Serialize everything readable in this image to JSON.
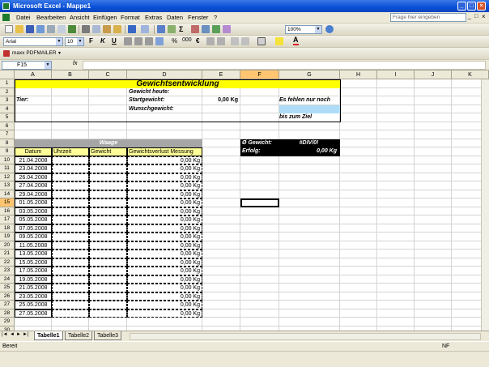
{
  "window": {
    "title": "Microsoft Excel - Mappe1"
  },
  "menu": {
    "items": [
      "Datei",
      "Bearbeiten",
      "Ansicht",
      "Einfügen",
      "Format",
      "Extras",
      "Daten",
      "Fenster",
      "?"
    ],
    "help_placeholder": "Frage hier eingeben"
  },
  "toolbar": {
    "zoom": "100%",
    "font": "Arial",
    "size": "10",
    "pdf_label": "maxx PDFMAILER"
  },
  "formula_bar": {
    "name_box": "F15",
    "fx": "fx",
    "content": ""
  },
  "grid": {
    "columns": [
      "A",
      "B",
      "C",
      "D",
      "E",
      "F",
      "G",
      "H",
      "I",
      "J",
      "K"
    ],
    "rows": [
      "1",
      "2",
      "3",
      "4",
      "5",
      "6",
      "7",
      "8",
      "9",
      "10",
      "11",
      "12",
      "13",
      "14",
      "15",
      "16",
      "17",
      "18",
      "19",
      "20",
      "21",
      "22",
      "23",
      "24",
      "25",
      "26",
      "27",
      "28",
      "29",
      "30"
    ],
    "selected_cell": "F15"
  },
  "sheet": {
    "title": "Gewichtsentwicklung",
    "tier_label": "Tier:",
    "gewicht_heute": "Gewicht heute:",
    "startgewicht": "Startgewicht:",
    "startgewicht_value": "0,00 Kg",
    "wunschgewicht": "Wunschgewicht:",
    "es_fehlen": "Es fehlen nur noch",
    "bis_zum_ziel": "bis zum Ziel",
    "waage": "Waage",
    "headers": [
      "Datum",
      "Uhrzeit",
      "Gewicht",
      "Gewichtsverlust Messung"
    ],
    "avg_label": "Ø Gewicht:",
    "avg_value": "#DIV/0!",
    "erfolg_label": "Erfolg:",
    "erfolg_value": "0,00 Kg",
    "dates": [
      "21.04.2008",
      "23.04.2008",
      "26.04.2008",
      "27.04.2008",
      "29.04.2008",
      "01.05.2008",
      "03.05.2008",
      "05.05.2008",
      "07.05.2008",
      "09.05.2008",
      "11.05.2008",
      "13.05.2008",
      "15.05.2008",
      "17.05.2008",
      "19.05.2008",
      "21.05.2008",
      "23.05.2008",
      "25.05.2008",
      "27.05.2008"
    ],
    "loss_value": "0,00 Kg"
  },
  "sheet_tabs": [
    "Tabelle1",
    "Tabelle2",
    "Tabelle3"
  ],
  "status": {
    "left": "Bereit",
    "right": "NF"
  }
}
